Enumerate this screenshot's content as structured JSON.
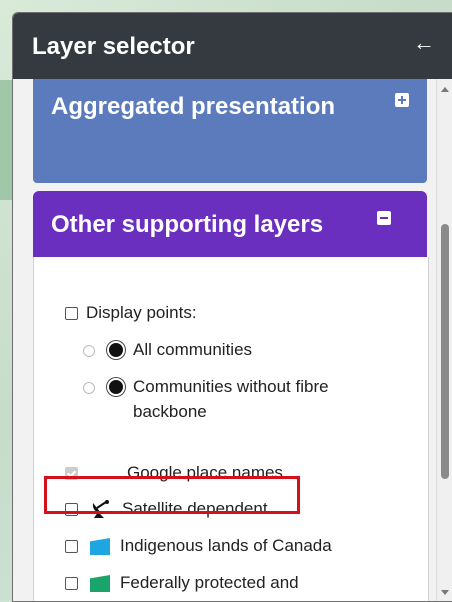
{
  "header": {
    "title": "Layer selector",
    "back_icon": "arrow-left-icon"
  },
  "aggregated": {
    "label": "Aggregated presentation",
    "toggle": "plus-square-icon"
  },
  "other": {
    "label": "Other supporting layers",
    "toggle": "minus-square-icon",
    "display_points": {
      "label": "Display points:",
      "checked": false,
      "options": [
        {
          "label": "All communities"
        },
        {
          "label": "Communities without fibre backbone"
        }
      ]
    },
    "layers": [
      {
        "label": "Google place names",
        "checked": true,
        "disabled": true
      },
      {
        "label": "Satellite dependent",
        "checked": false,
        "icon": "satellite-dish-icon"
      },
      {
        "label": "Indigenous lands of Canada",
        "checked": false,
        "color": "#1ea6e0"
      },
      {
        "label": "Federally protected and conserved areas",
        "checked": false,
        "color": "#1aa36a"
      }
    ]
  },
  "colors": {
    "header": "#343a40",
    "aggregated": "#5b7bbd",
    "other": "#6b2fbf",
    "highlight": "#d6101b"
  }
}
